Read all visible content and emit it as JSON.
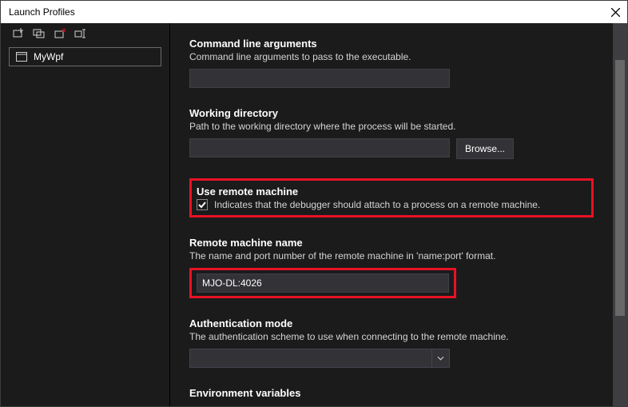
{
  "window": {
    "title": "Launch Profiles"
  },
  "sidebar": {
    "profile": {
      "name": "MyWpf"
    }
  },
  "sections": {
    "cmdArgs": {
      "title": "Command line arguments",
      "desc": "Command line arguments to pass to the executable.",
      "value": ""
    },
    "workingDir": {
      "title": "Working directory",
      "desc": "Path to the working directory where the process will be started.",
      "value": "",
      "browse": "Browse..."
    },
    "useRemote": {
      "title": "Use remote machine",
      "desc": "Indicates that the debugger should attach to a process on a remote machine."
    },
    "remoteName": {
      "title": "Remote machine name",
      "desc": "The name and port number of the remote machine in 'name:port' format.",
      "value": "MJO-DL:4026"
    },
    "authMode": {
      "title": "Authentication mode",
      "desc": "The authentication scheme to use when connecting to the remote machine."
    },
    "envVars": {
      "title": "Environment variables"
    }
  }
}
